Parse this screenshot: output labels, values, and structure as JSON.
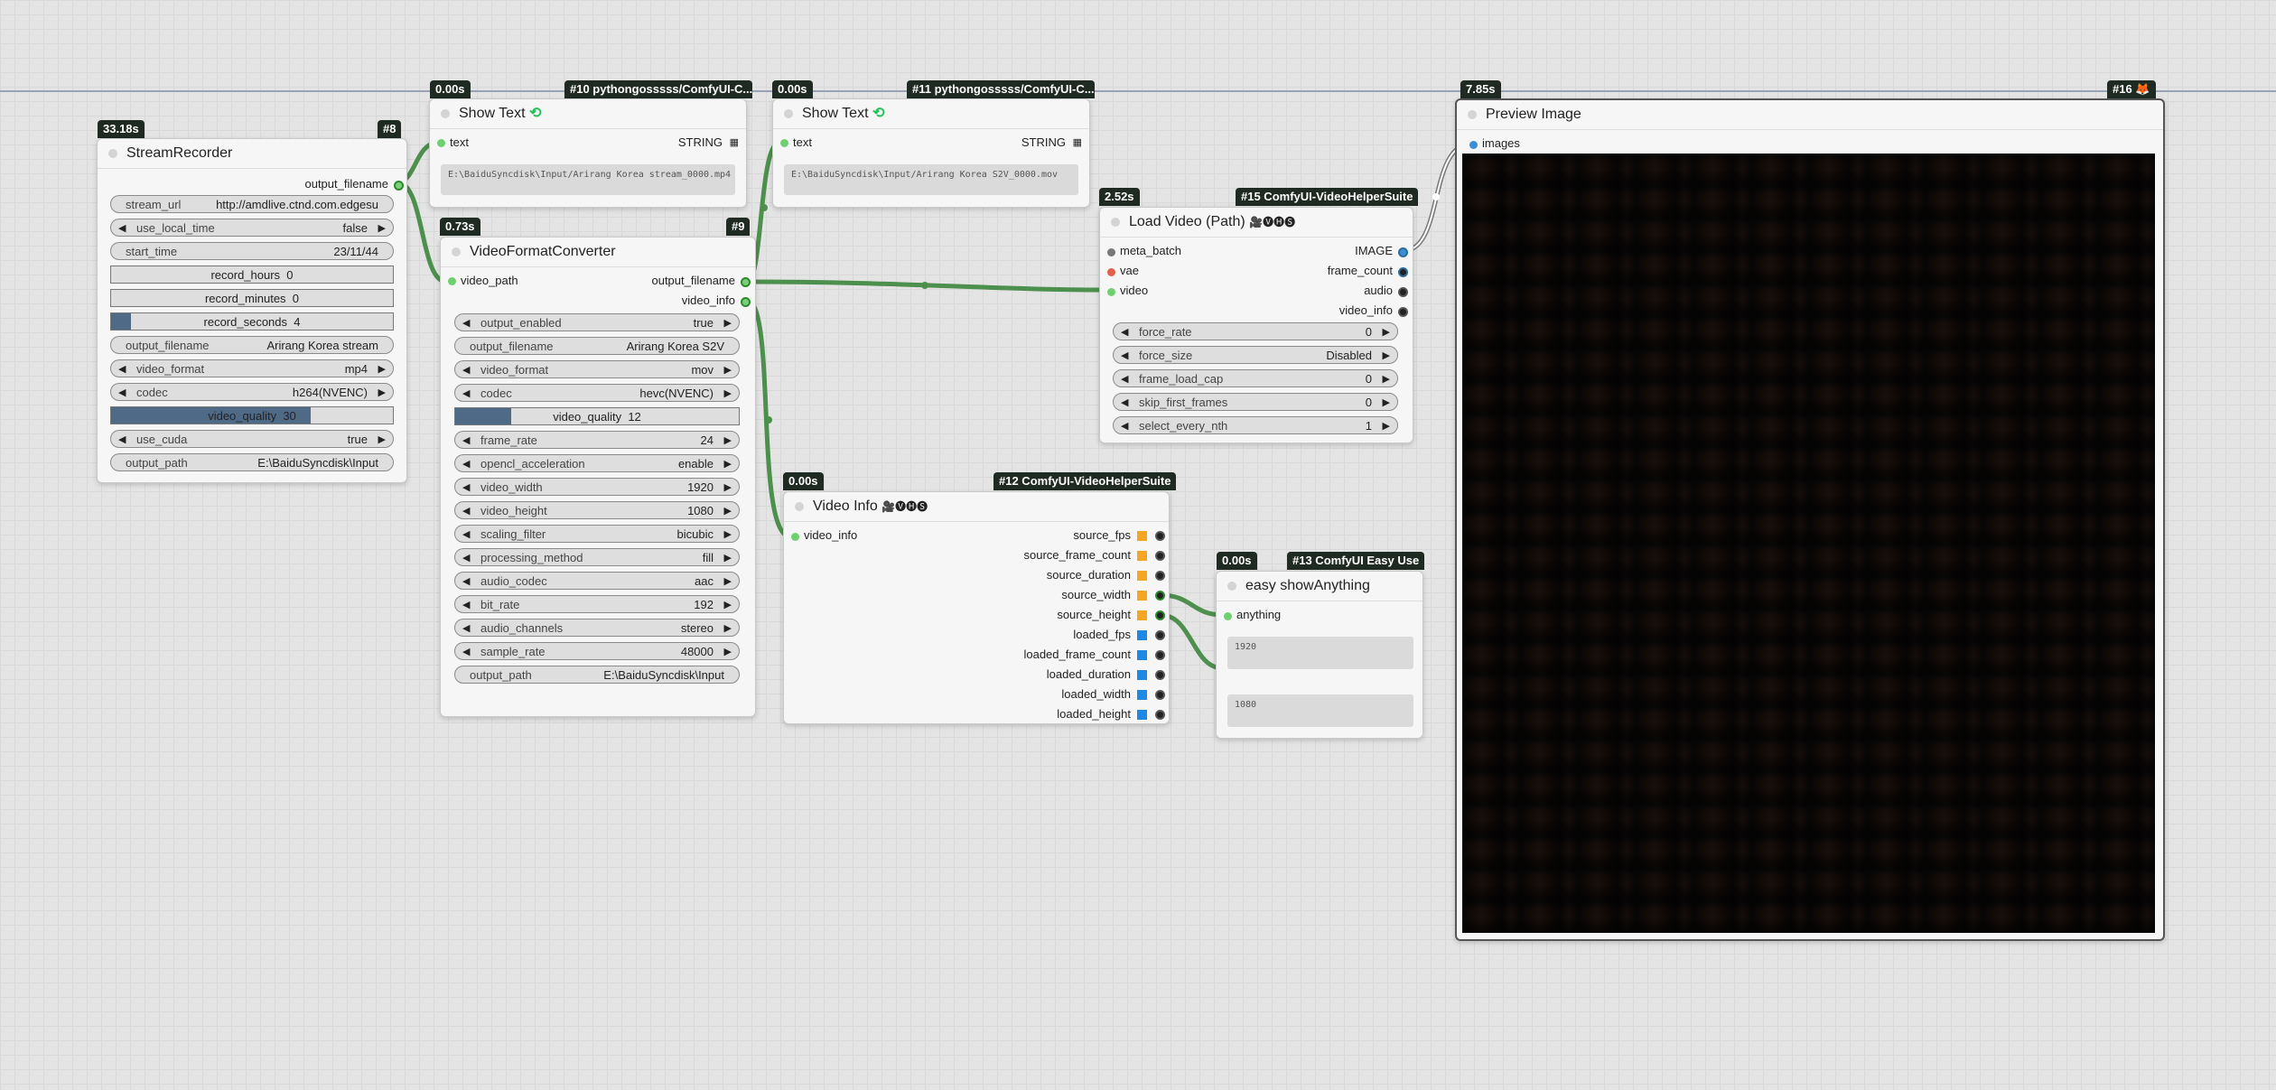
{
  "nodes": {
    "stream_recorder": {
      "badge_time": "33.18s",
      "badge_id": "#8",
      "title": "StreamRecorder",
      "output": "output_filename",
      "widgets": {
        "stream_url": {
          "label": "stream_url",
          "value": "http://amdlive.ctnd.com.edgesu"
        },
        "use_local_time": {
          "label": "use_local_time",
          "value": "false"
        },
        "start_time": {
          "label": "start_time",
          "value": "23/11/44"
        },
        "record_hours": {
          "label": "record_hours",
          "value": "0"
        },
        "record_minutes": {
          "label": "record_minutes",
          "value": "0"
        },
        "record_seconds": {
          "label": "record_seconds",
          "value": "4"
        },
        "output_filename": {
          "label": "output_filename",
          "value": "Arirang Korea stream"
        },
        "video_format": {
          "label": "video_format",
          "value": "mp4"
        },
        "codec": {
          "label": "codec",
          "value": "h264(NVENC)"
        },
        "video_quality": {
          "label": "video_quality",
          "value": "30"
        },
        "use_cuda": {
          "label": "use_cuda",
          "value": "true"
        },
        "output_path": {
          "label": "output_path",
          "value": "E:\\BaiduSyncdisk\\Input"
        }
      }
    },
    "show_text_10": {
      "badge_time": "0.00s",
      "badge_id": "#10 pythongosssss/ComfyUI-C...",
      "title": "Show Text",
      "input": "text",
      "output": "STRING",
      "text": "E:\\BaiduSyncdisk\\Input/Arirang Korea stream_0000.mp4"
    },
    "show_text_11": {
      "badge_time": "0.00s",
      "badge_id": "#11 pythongosssss/ComfyUI-C...",
      "title": "Show Text",
      "input": "text",
      "output": "STRING",
      "text": "E:\\BaiduSyncdisk\\Input/Arirang Korea S2V_0000.mov"
    },
    "video_format_converter": {
      "badge_time": "0.73s",
      "badge_id": "#9",
      "title": "VideoFormatConverter",
      "input": "video_path",
      "outputs": [
        "output_filename",
        "video_info"
      ],
      "widgets": {
        "output_enabled": {
          "label": "output_enabled",
          "value": "true"
        },
        "output_filename": {
          "label": "output_filename",
          "value": "Arirang Korea S2V"
        },
        "video_format": {
          "label": "video_format",
          "value": "mov"
        },
        "codec": {
          "label": "codec",
          "value": "hevc(NVENC)"
        },
        "video_quality": {
          "label": "video_quality",
          "value": "12"
        },
        "frame_rate": {
          "label": "frame_rate",
          "value": "24"
        },
        "opencl_acceleration": {
          "label": "opencl_acceleration",
          "value": "enable"
        },
        "video_width": {
          "label": "video_width",
          "value": "1920"
        },
        "video_height": {
          "label": "video_height",
          "value": "1080"
        },
        "scaling_filter": {
          "label": "scaling_filter",
          "value": "bicubic"
        },
        "processing_method": {
          "label": "processing_method",
          "value": "fill"
        },
        "audio_codec": {
          "label": "audio_codec",
          "value": "aac"
        },
        "bit_rate": {
          "label": "bit_rate",
          "value": "192"
        },
        "audio_channels": {
          "label": "audio_channels",
          "value": "stereo"
        },
        "sample_rate": {
          "label": "sample_rate",
          "value": "48000"
        },
        "output_path": {
          "label": "output_path",
          "value": "E:\\BaiduSyncdisk\\Input"
        }
      }
    },
    "load_video": {
      "badge_time": "2.52s",
      "badge_id": "#15 ComfyUI-VideoHelperSuite",
      "title": "Load Video (Path)",
      "title_suffix": "🎥🅥🅗🅢",
      "inputs": [
        "meta_batch",
        "vae",
        "video"
      ],
      "outputs": [
        "IMAGE",
        "frame_count",
        "audio",
        "video_info"
      ],
      "widgets": {
        "force_rate": {
          "label": "force_rate",
          "value": "0"
        },
        "force_size": {
          "label": "force_size",
          "value": "Disabled"
        },
        "frame_load_cap": {
          "label": "frame_load_cap",
          "value": "0"
        },
        "skip_first_frames": {
          "label": "skip_first_frames",
          "value": "0"
        },
        "select_every_nth": {
          "label": "select_every_nth",
          "value": "1"
        }
      }
    },
    "video_info": {
      "badge_time": "0.00s",
      "badge_id": "#12 ComfyUI-VideoHelperSuite",
      "title": "Video Info",
      "title_suffix": "🎥🅥🅗🅢",
      "input": "video_info",
      "outputs": [
        "source_fps",
        "source_frame_count",
        "source_duration",
        "source_width",
        "source_height",
        "loaded_fps",
        "loaded_frame_count",
        "loaded_duration",
        "loaded_width",
        "loaded_height"
      ]
    },
    "show_anything": {
      "badge_time": "0.00s",
      "badge_id": "#13 ComfyUI Easy Use",
      "title": "easy showAnything",
      "input": "anything",
      "values": [
        "1920",
        "1080"
      ]
    },
    "preview_image": {
      "badge_time": "7.85s",
      "badge_id": "#16 🦊",
      "title": "Preview Image",
      "input": "images"
    }
  },
  "colors": {
    "link": "#4d8f4d",
    "badge": "#1e2a22",
    "canvas": "#e4e4e4",
    "slider_fill": "#4f6a87"
  }
}
